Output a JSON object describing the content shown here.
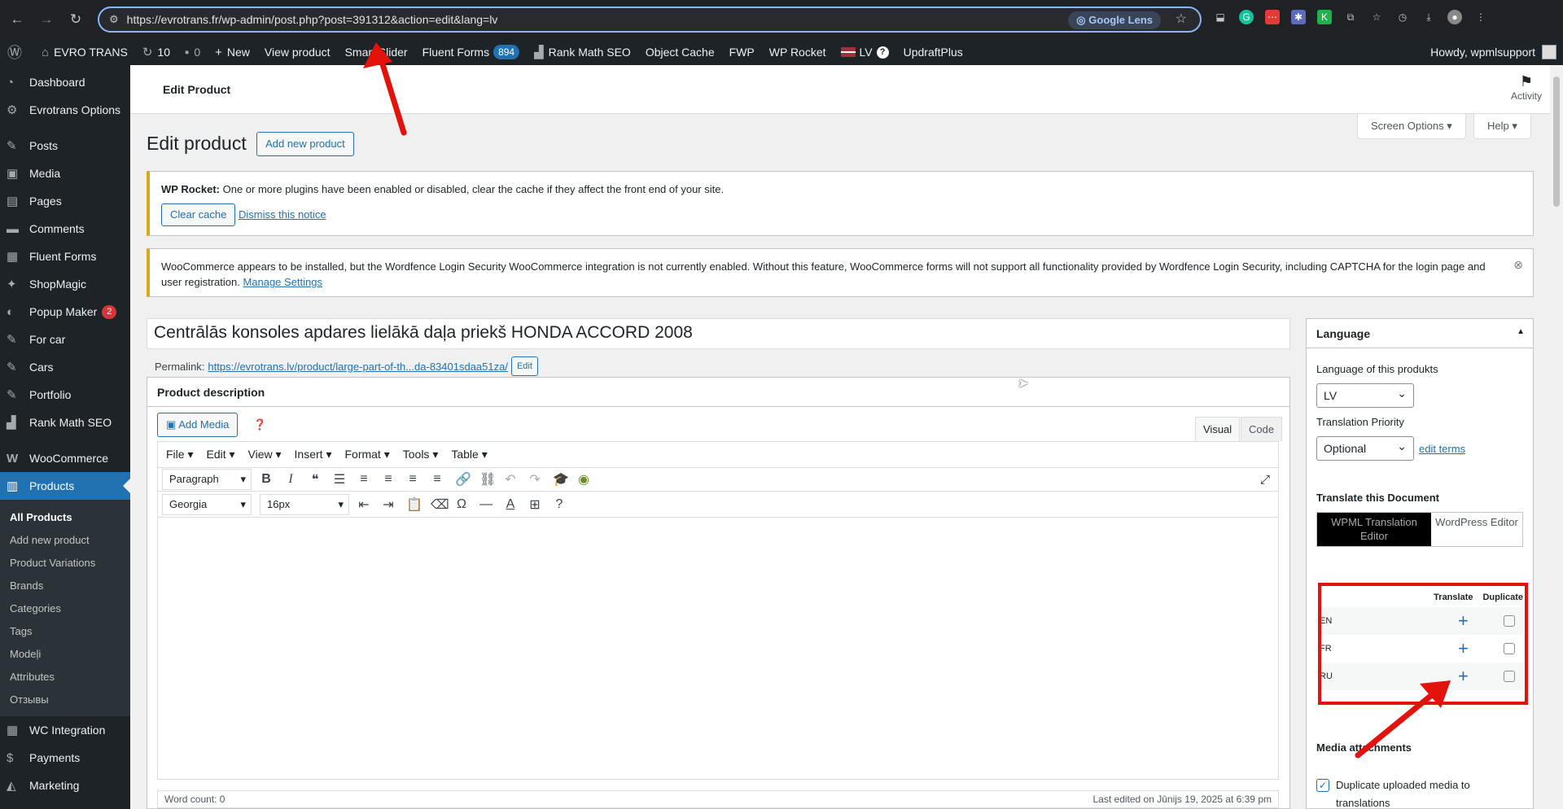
{
  "browser": {
    "url": "https://evrotrans.fr/wp-admin/post.php?post=391312&action=edit&lang=lv",
    "lens": "Google Lens"
  },
  "adminbar": {
    "site": "EVRO TRANS",
    "updates": "10",
    "comments": "0",
    "new": "New",
    "view": "View product",
    "smart": "Smart Slider",
    "fluent": "Fluent Forms",
    "fluent_count": "894",
    "rankmath": "Rank Math SEO",
    "cache": "Object Cache",
    "fwp": "FWP",
    "rocket": "WP Rocket",
    "lang": "LV",
    "updraft": "UpdraftPlus",
    "howdy": "Howdy, wpmlsupport"
  },
  "sidebar": {
    "items": [
      {
        "label": "Dashboard",
        "icon": "dashboard-icon"
      },
      {
        "label": "Evrotrans Options",
        "icon": "gear-icon"
      },
      {
        "label": "Posts",
        "icon": "pin-icon"
      },
      {
        "label": "Media",
        "icon": "media-icon"
      },
      {
        "label": "Pages",
        "icon": "pages-icon"
      },
      {
        "label": "Comments",
        "icon": "comment-icon"
      },
      {
        "label": "Fluent Forms",
        "icon": "forms-icon"
      },
      {
        "label": "ShopMagic",
        "icon": "wand-icon"
      },
      {
        "label": "Popup Maker",
        "icon": "popup-icon",
        "badge": "2"
      },
      {
        "label": "For car",
        "icon": "pin-icon"
      },
      {
        "label": "Cars",
        "icon": "pin-icon"
      },
      {
        "label": "Portfolio",
        "icon": "pin-icon"
      },
      {
        "label": "Rank Math SEO",
        "icon": "chart-icon"
      },
      {
        "label": "WooCommerce",
        "icon": "woo-icon"
      },
      {
        "label": "Products",
        "icon": "products-icon"
      },
      {
        "label": "WC Integration",
        "icon": "integration-icon"
      },
      {
        "label": "Payments",
        "icon": "payments-icon"
      },
      {
        "label": "Marketing",
        "icon": "marketing-icon"
      }
    ],
    "submenu": [
      "All Products",
      "Add new product",
      "Product Variations",
      "Brands",
      "Categories",
      "Tags",
      "Modeļi",
      "Attributes",
      "Отзывы"
    ]
  },
  "topbar": {
    "title": "Edit Product",
    "activity": "Activity"
  },
  "screen_options": "Screen Options ▾",
  "help": "Help ▾",
  "page": {
    "heading": "Edit product",
    "add_new": "Add new product"
  },
  "notice1": {
    "strong": "WP Rocket:",
    "text": " One or more plugins have been enabled or disabled, clear the cache if they affect the front end of your site.",
    "clear": "Clear cache",
    "dismiss": "Dismiss this notice"
  },
  "notice2": {
    "text": "WooCommerce appears to be installed, but the Wordfence Login Security WooCommerce integration is not currently enabled. Without this feature, WooCommerce forms will not support all functionality provided by Wordfence Login Security, including CAPTCHA for the login page and user registration. ",
    "link": "Manage Settings"
  },
  "product": {
    "title": "Centrālās konsoles apdares lielākā daļa priekš HONDA ACCORD 2008",
    "permalink_label": "Permalink:",
    "permalink": "https://evrotrans.lv/product/large-part-of-th...da-83401sdaa51za/",
    "edit": "Edit"
  },
  "editor": {
    "box_title": "Product description",
    "add_media": "Add Media",
    "tab_visual": "Visual",
    "tab_code": "Code",
    "menus": [
      "File",
      "Edit",
      "View",
      "Insert",
      "Format",
      "Tools",
      "Table"
    ],
    "paragraph": "Paragraph",
    "font": "Georgia",
    "size": "16px",
    "word_count": "Word count: 0",
    "last_edited": "Last edited on Jūnijs 19, 2025 at 6:39 pm"
  },
  "language": {
    "title": "Language",
    "of_this": "Language of this produkts",
    "lang_value": "LV",
    "priority_label": "Translation Priority",
    "priority_value": "Optional",
    "edit_terms": "edit terms",
    "translate_doc": "Translate this Document",
    "wpml_editor": "WPML Translation Editor",
    "wp_editor": "WordPress Editor",
    "col_translate": "Translate",
    "col_duplicate": "Duplicate",
    "rows": [
      "EN",
      "FR",
      "RU"
    ],
    "media_title": "Media attachments",
    "dup_media": "Duplicate uploaded media to translations"
  },
  "colors": {
    "admin_dark": "#1d2327",
    "accent": "#2271b1",
    "highlight": "#e3120b"
  }
}
